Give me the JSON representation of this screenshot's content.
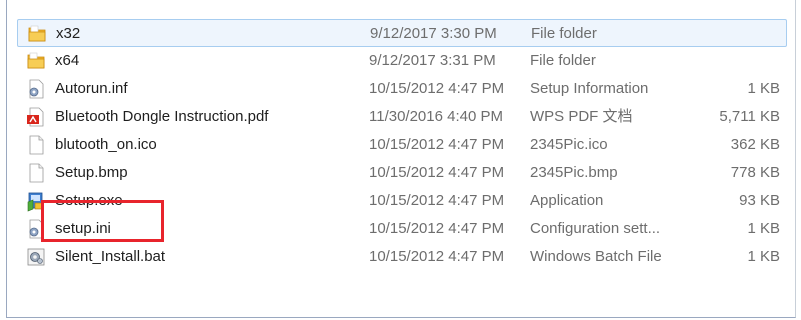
{
  "files": [
    {
      "name": "x32",
      "date": "9/12/2017 3:30 PM",
      "type": "File folder",
      "size": "",
      "icon": "folder-icon"
    },
    {
      "name": "x64",
      "date": "9/12/2017 3:31 PM",
      "type": "File folder",
      "size": "",
      "icon": "folder-icon"
    },
    {
      "name": "Autorun.inf",
      "date": "10/15/2012 4:47 PM",
      "type": "Setup Information",
      "size": "1 KB",
      "icon": "settings-file-icon"
    },
    {
      "name": "Bluetooth Dongle Instruction.pdf",
      "date": "11/30/2016 4:40 PM",
      "type": "WPS PDF 文档",
      "size": "5,711 KB",
      "icon": "pdf-file-icon"
    },
    {
      "name": "blutooth_on.ico",
      "date": "10/15/2012 4:47 PM",
      "type": "2345Pic.ico",
      "size": "362 KB",
      "icon": "blank-file-icon"
    },
    {
      "name": "Setup.bmp",
      "date": "10/15/2012 4:47 PM",
      "type": "2345Pic.bmp",
      "size": "778 KB",
      "icon": "blank-file-icon"
    },
    {
      "name": "Setup.exe",
      "date": "10/15/2012 4:47 PM",
      "type": "Application",
      "size": "93 KB",
      "icon": "installer-app-icon"
    },
    {
      "name": "setup.ini",
      "date": "10/15/2012 4:47 PM",
      "type": "Configuration sett...",
      "size": "1 KB",
      "icon": "settings-file-icon"
    },
    {
      "name": "Silent_Install.bat",
      "date": "10/15/2012 4:47 PM",
      "type": "Windows Batch File",
      "size": "1 KB",
      "icon": "batch-file-icon"
    }
  ],
  "selected_index": 0,
  "highlighted_index": 6,
  "colors": {
    "highlight": "#e8242c",
    "selection": "#eef5fd",
    "folder": "#f5c242",
    "pdf": "#d9261c"
  }
}
